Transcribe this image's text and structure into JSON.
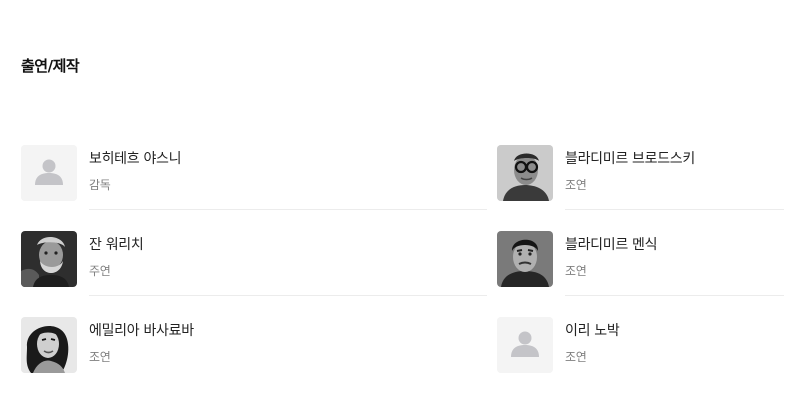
{
  "section": {
    "title": "출연/제작"
  },
  "cast": [
    {
      "name": "보히테흐 야스니",
      "role": "감독",
      "photo": "placeholder"
    },
    {
      "name": "블라디미르 브로드스키",
      "role": "조연",
      "photo": "glasses"
    },
    {
      "name": "잔 워리치",
      "role": "주연",
      "photo": "bearded"
    },
    {
      "name": "블라디미르 멘식",
      "role": "조연",
      "photo": "dark-hair"
    },
    {
      "name": "에밀리아 바사료바",
      "role": "조연",
      "photo": "woman"
    },
    {
      "name": "이리 노박",
      "role": "조연",
      "photo": "placeholder"
    }
  ],
  "colors": {
    "placeholder_bg": "#f4f4f4",
    "placeholder_icon": "#c4c4c8",
    "divider": "#ececec",
    "role_text": "#808080"
  }
}
